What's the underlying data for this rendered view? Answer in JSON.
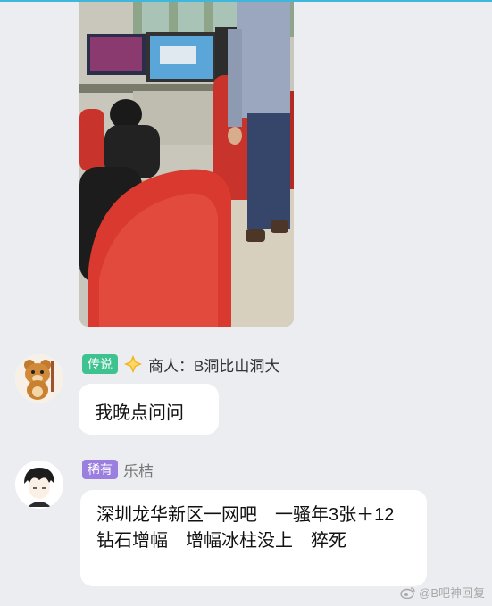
{
  "chat": {
    "messages": [
      {
        "type": "image",
        "icon": "photo-internet-cafe"
      },
      {
        "type": "text",
        "badge": "传说",
        "badge_color": "#3ec28f",
        "name_icon": "diamond-icon",
        "name": "商人：B洞比山洞大",
        "avatar_icon": "bear-avatar-icon",
        "text": "我晚点问问"
      },
      {
        "type": "text",
        "badge": "稀有",
        "badge_color": "#9b7fe0",
        "name": "乐桔",
        "avatar_icon": "anime-boy-avatar-icon",
        "text": "深圳龙华新区一网吧　一骚年3张＋12钻石增幅　增幅冰柱没上　猝死"
      }
    ]
  },
  "watermark": {
    "text": "@B吧神回复",
    "icon": "weibo-icon"
  },
  "colors": {
    "background": "#ecedf1",
    "bubble": "#ffffff",
    "accent_line": "#3fb7dd"
  }
}
